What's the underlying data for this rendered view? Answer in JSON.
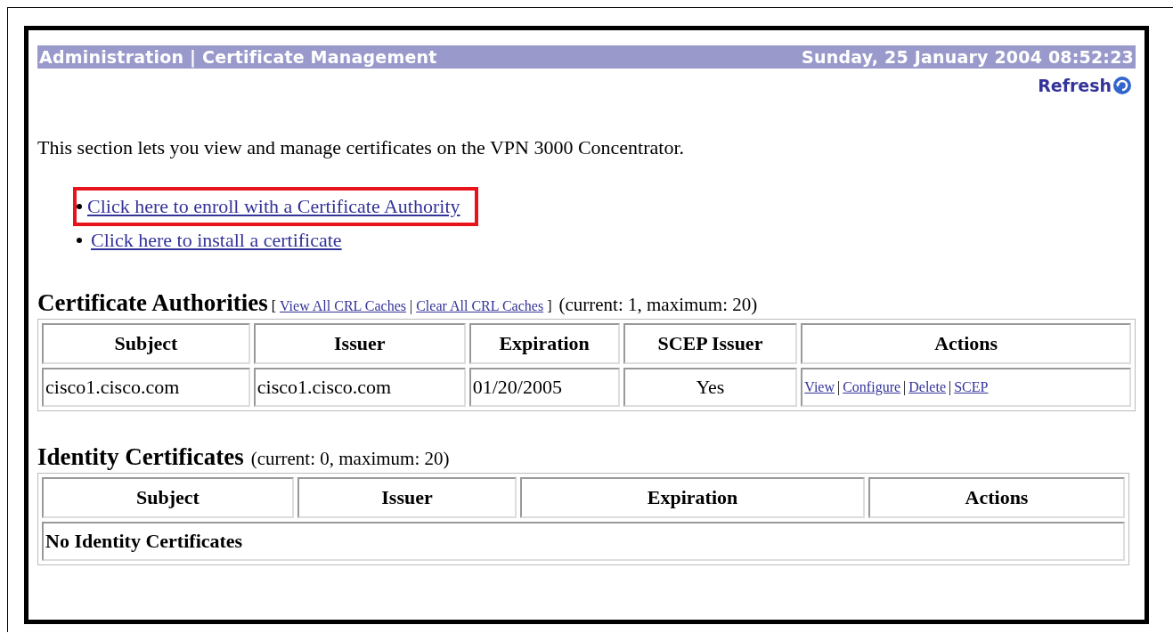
{
  "header": {
    "title": "Administration | Certificate Management",
    "datetime": "Sunday, 25 January 2004 08:52:23"
  },
  "refresh": {
    "label": "Refresh"
  },
  "intro": "This section lets you view and manage certificates on the VPN 3000 Concentrator.",
  "links": [
    {
      "label": "Click here to enroll with a Certificate Authority",
      "highlighted": true
    },
    {
      "label": "Click here to install a certificate",
      "highlighted": false
    }
  ],
  "sections": [
    {
      "title": "Certificate Authorities",
      "bracket_open": "[",
      "bracket_close": "]",
      "separator": "|",
      "actions": [
        "View All CRL Caches",
        "Clear All CRL Caches"
      ],
      "summary": "(current: 1, maximum: 20)",
      "columns": [
        "Subject",
        "Issuer",
        "Expiration",
        "SCEP Issuer",
        "Actions"
      ],
      "rows": [
        {
          "cells": [
            "cisco1.cisco.com",
            "cisco1.cisco.com",
            "01/20/2005",
            "Yes"
          ],
          "actions": [
            "View",
            "Configure",
            "Delete",
            "SCEP"
          ],
          "separator": "|"
        }
      ]
    },
    {
      "title": "Identity Certificates",
      "summary": "(current: 0, maximum: 20)",
      "columns": [
        "Subject",
        "Issuer",
        "Expiration",
        "Actions"
      ],
      "empty_message": "No Identity Certificates"
    }
  ]
}
